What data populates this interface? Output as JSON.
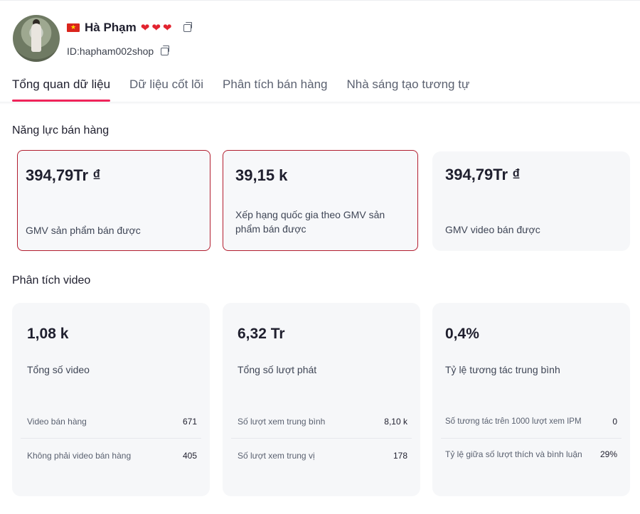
{
  "profile": {
    "name": "Hà Phạm",
    "hearts": "❤❤❤",
    "id_text": "ID:hapham002shop"
  },
  "tabs": [
    {
      "label": "Tổng quan dữ liệu",
      "active": true
    },
    {
      "label": "Dữ liệu cốt lõi",
      "active": false
    },
    {
      "label": "Phân tích bán hàng",
      "active": false
    },
    {
      "label": "Nhà sáng tạo tương tự",
      "active": false
    }
  ],
  "sales": {
    "title": "Năng lực bán hàng",
    "cards": [
      {
        "value": "394,79Tr ₫",
        "label": "GMV sản phẩm bán được"
      },
      {
        "value": "39,15 k",
        "label": "Xếp hạng quốc gia theo GMV sản phẩm bán được"
      },
      {
        "value": "394,79Tr ₫",
        "label": "GMV video bán được"
      }
    ]
  },
  "video": {
    "title": "Phân tích video",
    "cards": [
      {
        "value": "1,08 k",
        "label": "Tổng số video",
        "rows": [
          {
            "key": "Video bán hàng",
            "val": "671"
          },
          {
            "key": "Không phải video bán hàng",
            "val": "405"
          }
        ]
      },
      {
        "value": "6,32 Tr",
        "label": "Tổng số lượt phát",
        "rows": [
          {
            "key": "Số lượt xem trung bình",
            "val": "8,10 k"
          },
          {
            "key": "Số lượt xem trung vị",
            "val": "178"
          }
        ]
      },
      {
        "value": "0,4%",
        "label": "Tỷ lệ tương tác trung bình",
        "rows": [
          {
            "key": "Số tương tác trên 1000 lượt xem IPM",
            "val": "0"
          },
          {
            "key": "Tỷ lệ giữa số lượt thích và bình luận",
            "val": "29%"
          }
        ]
      }
    ]
  },
  "colors": {
    "tab_underline": "#f0245a",
    "highlight_border": "#b21d2e",
    "card_bg": "#f6f7f9"
  },
  "icons": [
    "vietnam-flag-icon",
    "heart-icon",
    "copy-icon"
  ]
}
